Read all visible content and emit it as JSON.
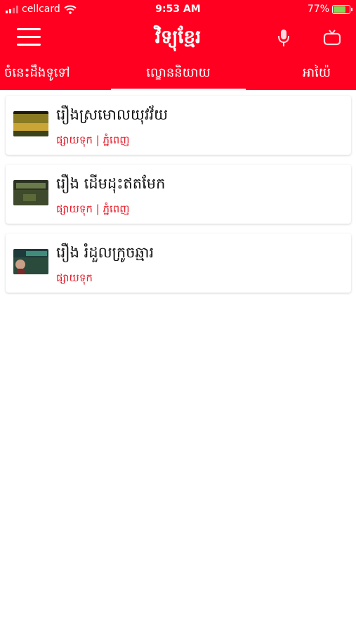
{
  "status_bar": {
    "carrier": "cellcard",
    "time": "9:53 AM",
    "battery": "77%",
    "battery_level": 0.77
  },
  "app_bar": {
    "title": "វិទ្យុខ្មែរ",
    "menu_icon": "menu-icon",
    "mic_icon": "microphone-icon",
    "tv_icon": "tv-icon"
  },
  "tabs": [
    {
      "label": "ចំនេះដឹងទូទៅ",
      "selected": false
    },
    {
      "label": "ល្ខោននិយាយ",
      "selected": true
    },
    {
      "label": "អាយ៉ៃ",
      "selected": false
    }
  ],
  "items": [
    {
      "title": "រឿងស្រមោលយុវវ័យ",
      "subtitle": "ផ្សាយទុក | ភ្នំពេញ"
    },
    {
      "title": "រឿង ដើមដុះឥតមែក",
      "subtitle": "ផ្សាយទុក | ភ្នំពេញ"
    },
    {
      "title": "រឿង រំដួលក្រូចឆ្មារ",
      "subtitle": "ផ្សាយទុក"
    }
  ],
  "colors": {
    "brand_red": "#ff0020",
    "subtitle_red": "#e8202e"
  }
}
